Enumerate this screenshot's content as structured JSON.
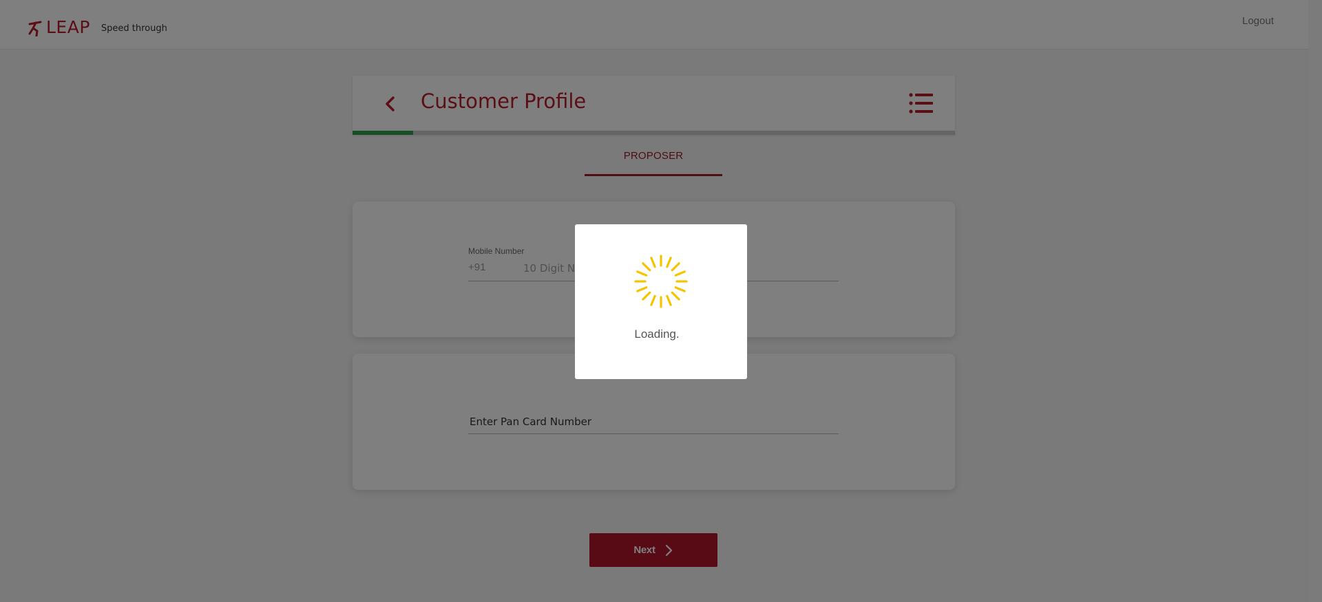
{
  "header": {
    "logo_text": "LEAP",
    "tagline": "Speed through",
    "logout_label": "Logout"
  },
  "page": {
    "title": "Customer Profile",
    "progress_fraction": 0.1
  },
  "tabs": [
    {
      "label": "PROPOSER",
      "active": true
    }
  ],
  "form": {
    "mobile_label": "Mobile Number",
    "mobile_prefix": "+91",
    "mobile_placeholder": "10 Digit No",
    "pan_placeholder": "Enter Pan Card Number"
  },
  "actions": {
    "next_label": "Next"
  },
  "loading": {
    "text": "Loading."
  },
  "colors": {
    "brand": "#b71c2b",
    "progress": "#2e9a4f",
    "spinner": "#f5c400"
  }
}
